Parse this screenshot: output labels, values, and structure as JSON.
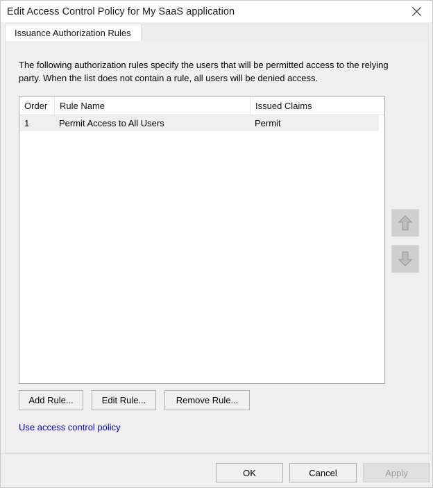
{
  "window": {
    "title": "Edit Access Control Policy for My SaaS application",
    "close_icon": "close-x-icon"
  },
  "tabs": [
    {
      "label": "Issuance Authorization Rules",
      "selected": true
    }
  ],
  "content": {
    "description": "The following authorization rules specify the users that will be permitted access to the relying party. When the list does not contain a rule, all users will be denied access.",
    "list": {
      "columns": [
        "Order",
        "Rule Name",
        "Issued Claims"
      ],
      "rows": [
        {
          "order": "1",
          "rule_name": "Permit Access to All Users",
          "issued_claims": "Permit",
          "selected": true
        }
      ]
    },
    "reorder": {
      "move_up_icon": "arrow-up-icon",
      "move_down_icon": "arrow-down-icon",
      "move_up_enabled": false,
      "move_down_enabled": false
    },
    "buttons": {
      "add_rule": "Add Rule...",
      "edit_rule": "Edit Rule...",
      "remove_rule": "Remove Rule..."
    },
    "link": {
      "label": "Use access control policy",
      "color": "#0000cd"
    }
  },
  "footer": {
    "ok": "OK",
    "cancel": "Cancel",
    "apply": "Apply",
    "apply_enabled": false
  }
}
